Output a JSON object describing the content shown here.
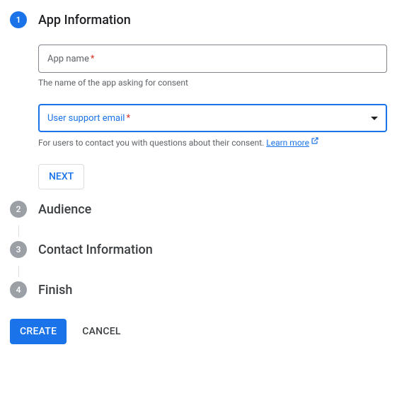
{
  "steps": [
    {
      "number": "1",
      "title": "App Information",
      "active": true
    },
    {
      "number": "2",
      "title": "Audience",
      "active": false
    },
    {
      "number": "3",
      "title": "Contact Information",
      "active": false
    },
    {
      "number": "4",
      "title": "Finish",
      "active": false
    }
  ],
  "form": {
    "app_name": {
      "label": "App name",
      "required": "*",
      "helper": "The name of the app asking for consent"
    },
    "support_email": {
      "label": "User support email",
      "required": "*",
      "helper_prefix": "For users to contact you with questions about their consent. ",
      "learn_more": "Learn more"
    },
    "next_label": "NEXT"
  },
  "footer": {
    "create": "CREATE",
    "cancel": "CANCEL"
  }
}
